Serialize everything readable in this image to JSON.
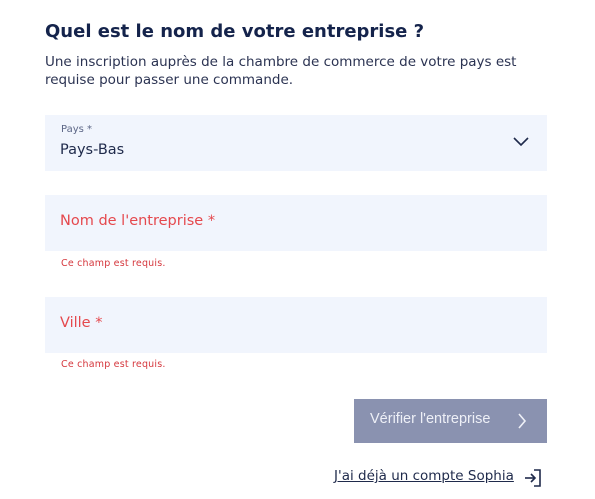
{
  "form": {
    "title": "Quel est le nom de votre entreprise ?",
    "subtitle": "Une inscription auprès de la chambre de commerce de votre pays est requise pour passer une commande.",
    "country": {
      "label": "Pays *",
      "value": "Pays-Bas",
      "icon": "chevron-down-icon"
    },
    "company": {
      "placeholder": "Nom de l'entreprise *",
      "value": "",
      "error": "Ce champ est requis."
    },
    "city": {
      "placeholder": "Ville *",
      "value": "",
      "error": "Ce champ est requis."
    },
    "verify_button": {
      "label": "Vérifier l'entreprise",
      "icon": "chevron-right-icon",
      "background": "#8a92b0"
    },
    "login_link": {
      "label": "J'ai déjà un compte Sophia",
      "icon": "login-icon"
    }
  },
  "colors": {
    "title": "#14234b",
    "field_background": "#f1f5fd",
    "error": "#e5484d"
  }
}
